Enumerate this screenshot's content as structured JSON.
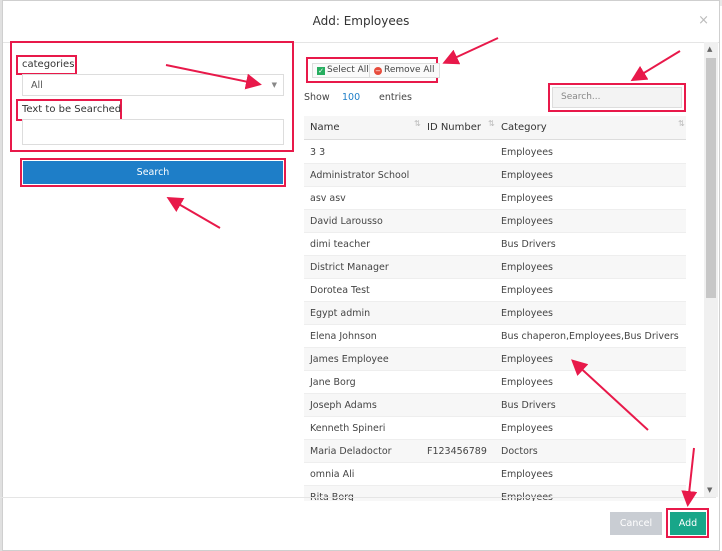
{
  "dialog": {
    "title": "Add: Employees",
    "close_glyph": "×"
  },
  "filters": {
    "categories_label": "categories",
    "categories_selected": "All",
    "text_label": "Text to be Searched",
    "text_value": "",
    "search_button": "Search"
  },
  "bulk": {
    "select_all": "Select All",
    "remove_all": "Remove All"
  },
  "length": {
    "show": "Show",
    "value": "100",
    "entries": "entries"
  },
  "search": {
    "placeholder": "Search..."
  },
  "table": {
    "headers": [
      "Name",
      "ID Number",
      "Category"
    ],
    "rows": [
      {
        "name": "3 3",
        "id": "",
        "category": "Employees"
      },
      {
        "name": "Administrator School",
        "id": "",
        "category": "Employees"
      },
      {
        "name": "asv asv",
        "id": "",
        "category": "Employees"
      },
      {
        "name": "David Larousso",
        "id": "",
        "category": "Employees"
      },
      {
        "name": "dimi teacher",
        "id": "",
        "category": "Bus Drivers"
      },
      {
        "name": "District Manager",
        "id": "",
        "category": "Employees"
      },
      {
        "name": "Dorotea Test",
        "id": "",
        "category": "Employees"
      },
      {
        "name": "Egypt admin",
        "id": "",
        "category": "Employees"
      },
      {
        "name": "Elena Johnson",
        "id": "",
        "category": "Bus chaperon,Employees,Bus Drivers"
      },
      {
        "name": "James Employee",
        "id": "",
        "category": "Employees"
      },
      {
        "name": "Jane Borg",
        "id": "",
        "category": "Employees"
      },
      {
        "name": "Joseph Adams",
        "id": "",
        "category": "Bus Drivers"
      },
      {
        "name": "Kenneth Spineri",
        "id": "",
        "category": "Employees"
      },
      {
        "name": "Maria Deladoctor",
        "id": "F123456789",
        "category": "Doctors"
      },
      {
        "name": "omnia Ali",
        "id": "",
        "category": "Employees"
      },
      {
        "name": "Rita Borg",
        "id": "",
        "category": "Employees"
      }
    ]
  },
  "footer": {
    "cancel": "Cancel",
    "add": "Add"
  },
  "colors": {
    "highlight": "#e8194a",
    "primary": "#1e7ec8",
    "add": "#18a689",
    "cancel": "#c9cdd3"
  }
}
